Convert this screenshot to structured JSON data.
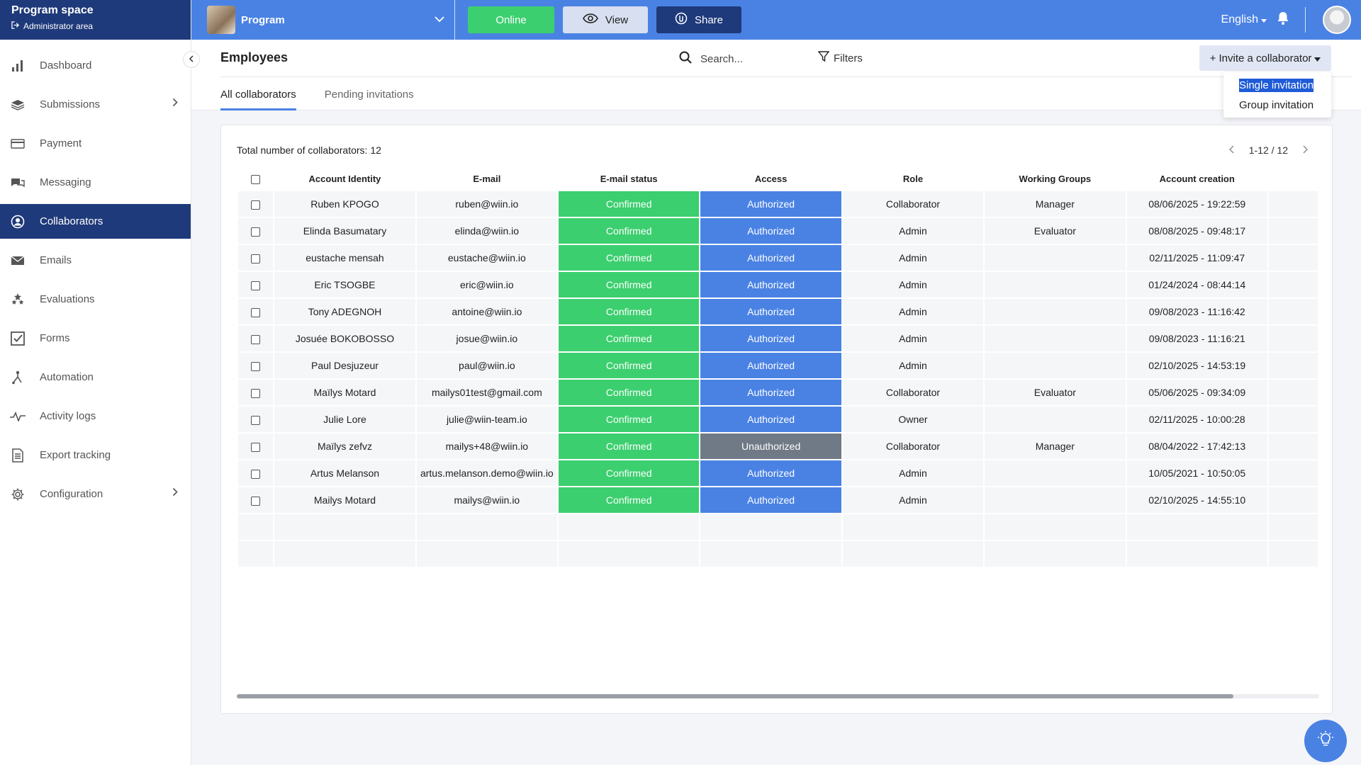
{
  "brand": {
    "title": "Program space",
    "subtitle": "Administrator area"
  },
  "nav": [
    {
      "label": "Dashboard",
      "icon": "bar-chart-icon"
    },
    {
      "label": "Submissions",
      "icon": "layers-icon",
      "expandable": true
    },
    {
      "label": "Payment",
      "icon": "card-icon"
    },
    {
      "label": "Messaging",
      "icon": "chat-icon"
    },
    {
      "label": "Collaborators",
      "icon": "user-circle-icon",
      "active": true
    },
    {
      "label": "Emails",
      "icon": "envelope-icon"
    },
    {
      "label": "Evaluations",
      "icon": "stars-icon"
    },
    {
      "label": "Forms",
      "icon": "checkbox-icon"
    },
    {
      "label": "Automation",
      "icon": "automation-icon"
    },
    {
      "label": "Activity logs",
      "icon": "pulse-icon"
    },
    {
      "label": "Export tracking",
      "icon": "document-icon"
    },
    {
      "label": "Configuration",
      "icon": "gear-icon",
      "expandable": true
    }
  ],
  "topbar": {
    "program_name": "Program",
    "online_label": "Online",
    "view_label": "View",
    "share_label": "Share",
    "language": "English"
  },
  "header": {
    "title": "Employees",
    "search_placeholder": "Search...",
    "filters_label": "Filters",
    "invite_label": "+ Invite a collaborator",
    "tabs": [
      "All collaborators",
      "Pending invitations"
    ],
    "active_tab": 0
  },
  "invite_menu": {
    "items": [
      "Single invitation",
      "Group invitation"
    ],
    "selected": 0
  },
  "table": {
    "total_label": "Total number of collaborators: 12",
    "pagination": "1-12 / 12",
    "columns": [
      "Account Identity",
      "E-mail",
      "E-mail status",
      "Access",
      "Role",
      "Working Groups",
      "Account creation"
    ],
    "rows": [
      [
        "Ruben KPOGO",
        "ruben@wiin.io",
        "Confirmed",
        "Authorized",
        "Collaborator",
        "Manager",
        "08/06/2025 - 19:22:59"
      ],
      [
        "Elinda Basumatary",
        "elinda@wiin.io",
        "Confirmed",
        "Authorized",
        "Admin",
        "Evaluator",
        "08/08/2025 - 09:48:17"
      ],
      [
        "eustache mensah",
        "eustache@wiin.io",
        "Confirmed",
        "Authorized",
        "Admin",
        "",
        "02/11/2025 - 11:09:47"
      ],
      [
        "Eric TSOGBE",
        "eric@wiin.io",
        "Confirmed",
        "Authorized",
        "Admin",
        "",
        "01/24/2024 - 08:44:14"
      ],
      [
        "Tony ADEGNOH",
        "antoine@wiin.io",
        "Confirmed",
        "Authorized",
        "Admin",
        "",
        "09/08/2023 - 11:16:42"
      ],
      [
        "Josuée BOKOBOSSO",
        "josue@wiin.io",
        "Confirmed",
        "Authorized",
        "Admin",
        "",
        "09/08/2023 - 11:16:21"
      ],
      [
        "Paul Desjuzeur",
        "paul@wiin.io",
        "Confirmed",
        "Authorized",
        "Admin",
        "",
        "02/10/2025 - 14:53:19"
      ],
      [
        "Maïlys Motard",
        "mailys01test@gmail.com",
        "Confirmed",
        "Authorized",
        "Collaborator",
        "Evaluator",
        "05/06/2025 - 09:34:09"
      ],
      [
        "Julie Lore",
        "julie@wiin-team.io",
        "Confirmed",
        "Authorized",
        "Owner",
        "",
        "02/11/2025 - 10:00:28"
      ],
      [
        "Maïlys zefvz",
        "mailys+48@wiin.io",
        "Confirmed",
        "Unauthorized",
        "Collaborator",
        "Manager",
        "08/04/2022 - 17:42:13"
      ],
      [
        "Artus Melanson",
        "artus.melanson.demo@wiin.io",
        "Confirmed",
        "Authorized",
        "Admin",
        "",
        "10/05/2021 - 10:50:05"
      ],
      [
        "Mailys Motard",
        "mailys@wiin.io",
        "Confirmed",
        "Authorized",
        "Admin",
        "",
        "02/10/2025 - 14:55:10"
      ]
    ],
    "empty_rows": 2
  },
  "colors": {
    "brand_dark": "#1f3a7a",
    "brand_blue": "#4a82e4",
    "confirmed_green": "#3ccf6f",
    "unauthorized_gray": "#707a86"
  }
}
